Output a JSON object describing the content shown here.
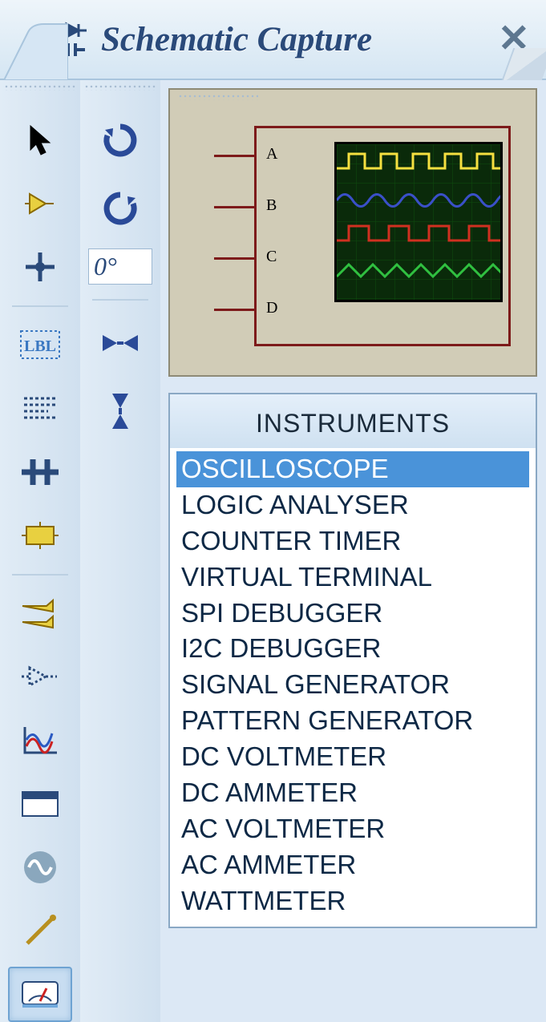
{
  "tab": {
    "title": "Schematic Capture"
  },
  "rotate": {
    "angle_text": "0°"
  },
  "preview": {
    "pin_labels": [
      "A",
      "B",
      "C",
      "D"
    ]
  },
  "instruments": {
    "header": "INSTRUMENTS",
    "selected_index": 0,
    "items": [
      "OSCILLOSCOPE",
      "LOGIC ANALYSER",
      "COUNTER TIMER",
      "VIRTUAL TERMINAL",
      "SPI DEBUGGER",
      "I2C DEBUGGER",
      "SIGNAL GENERATOR",
      "PATTERN GENERATOR",
      "DC VOLTMETER",
      "DC AMMETER",
      "AC VOLTMETER",
      "AC AMMETER",
      "WATTMETER"
    ]
  },
  "left_toolbar": {
    "selected_tool": "instruments"
  },
  "icons": {
    "lbl": "LBL"
  }
}
